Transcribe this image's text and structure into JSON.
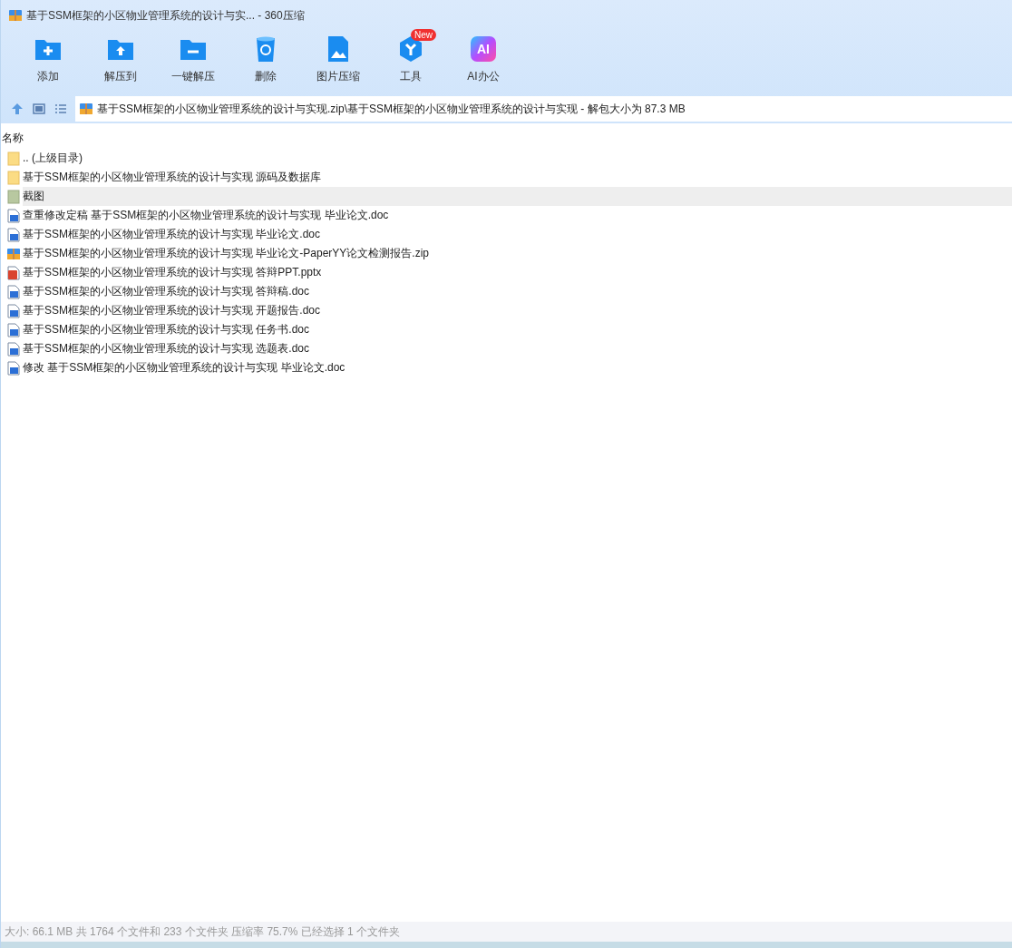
{
  "window": {
    "title": "基于SSM框架的小区物业管理系统的设计与实... - 360压缩"
  },
  "toolbar": [
    {
      "label": "添加",
      "kind": "add"
    },
    {
      "label": "解压到",
      "kind": "extract"
    },
    {
      "label": "一键解压",
      "kind": "quick"
    },
    {
      "label": "删除",
      "kind": "delete"
    },
    {
      "label": "图片压缩",
      "kind": "image"
    },
    {
      "label": "工具",
      "kind": "tools",
      "badge": "New"
    },
    {
      "label": "AI办公",
      "kind": "ai",
      "icon_text": "AI"
    }
  ],
  "address": {
    "value": "基于SSM框架的小区物业管理系统的设计与实现.zip\\基于SSM框架的小区物业管理系统的设计与实现 - 解包大小为 87.3 MB"
  },
  "table": {
    "columns": [
      "名称"
    ],
    "rows": [
      {
        "name": ".. (上级目录)",
        "kind": "folder",
        "selected": false
      },
      {
        "name": "基于SSM框架的小区物业管理系统的设计与实现 源码及数据库",
        "kind": "folder",
        "selected": false
      },
      {
        "name": "截图",
        "kind": "image-folder",
        "selected": true
      },
      {
        "name": "查重修改定稿 基于SSM框架的小区物业管理系统的设计与实现 毕业论文.doc",
        "kind": "doc",
        "selected": false
      },
      {
        "name": "基于SSM框架的小区物业管理系统的设计与实现 毕业论文.doc",
        "kind": "doc",
        "selected": false
      },
      {
        "name": "基于SSM框架的小区物业管理系统的设计与实现 毕业论文-PaperYY论文检测报告.zip",
        "kind": "zip",
        "selected": false
      },
      {
        "name": "基于SSM框架的小区物业管理系统的设计与实现 答辩PPT.pptx",
        "kind": "pptx",
        "selected": false
      },
      {
        "name": "基于SSM框架的小区物业管理系统的设计与实现 答辩稿.doc",
        "kind": "doc",
        "selected": false
      },
      {
        "name": "基于SSM框架的小区物业管理系统的设计与实现 开题报告.doc",
        "kind": "doc",
        "selected": false
      },
      {
        "name": "基于SSM框架的小区物业管理系统的设计与实现 任务书.doc",
        "kind": "doc",
        "selected": false
      },
      {
        "name": "基于SSM框架的小区物业管理系统的设计与实现 选题表.doc",
        "kind": "doc",
        "selected": false
      },
      {
        "name": "修改 基于SSM框架的小区物业管理系统的设计与实现 毕业论文.doc",
        "kind": "doc",
        "selected": false
      }
    ]
  },
  "status_bar": "大小: 66.1 MB 共 1764 个文件和 233 个文件夹 压缩率 75.7% 已经选择 1 个文件夹"
}
